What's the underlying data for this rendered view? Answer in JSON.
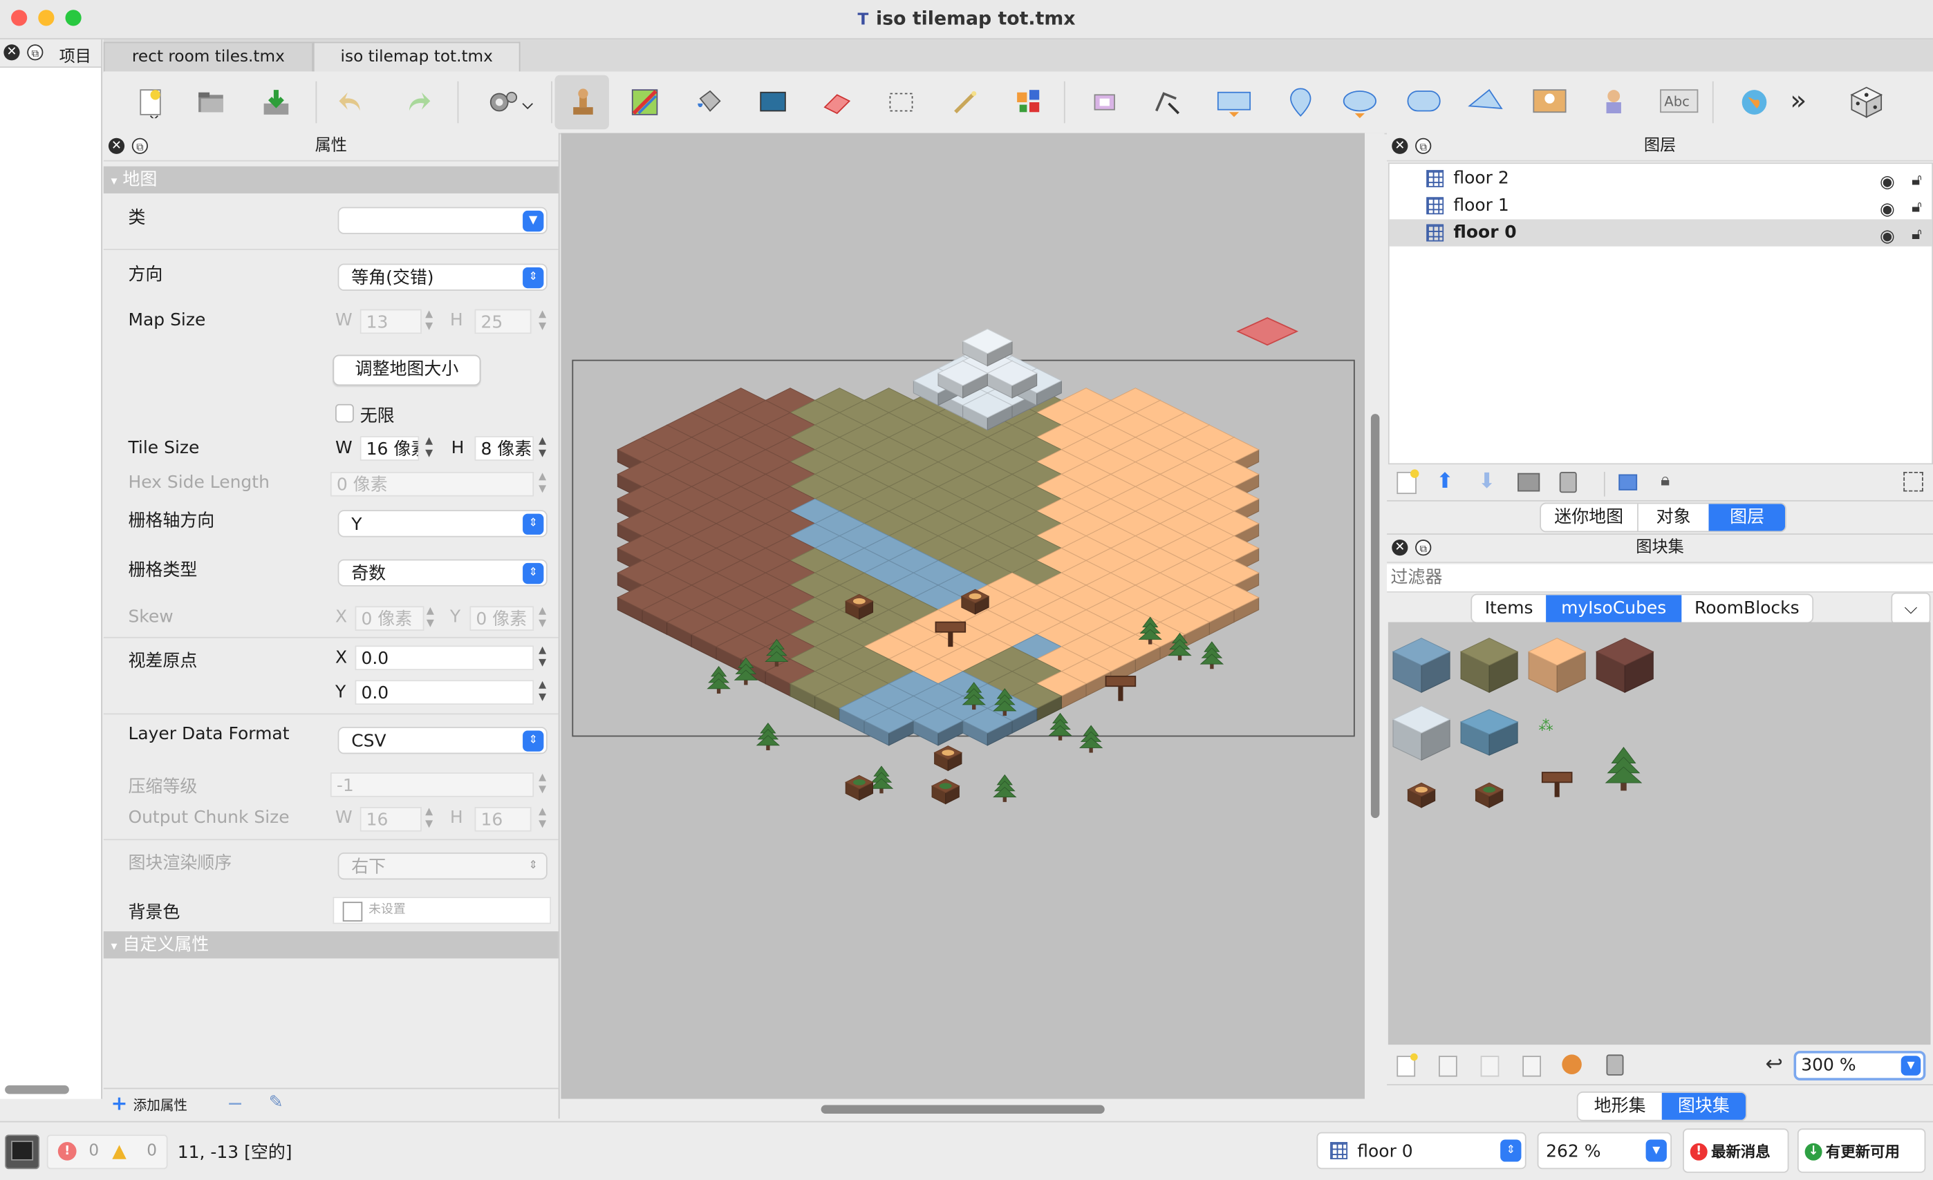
{
  "window": {
    "title": "iso tilemap tot.tmx",
    "traffic_light_colors": [
      "#fe5f57",
      "#febc2e",
      "#28c840"
    ]
  },
  "project_panel": {
    "title": "项目"
  },
  "tabs": [
    {
      "label": "rect room tiles.tmx",
      "active": false
    },
    {
      "label": "iso tilemap tot.tmx",
      "active": true
    }
  ],
  "toolbar": {
    "icons": [
      "new-map-icon",
      "open-icon",
      "save-icon",
      "undo-icon",
      "redo-icon",
      "command-gear-icon",
      "stamp-brush-icon",
      "terrain-brush-icon",
      "bucket-fill-icon",
      "shape-fill-icon",
      "eraser-icon",
      "rect-select-icon",
      "magic-wand-icon",
      "select-same-tile-icon",
      "select-objects-icon",
      "edit-polygons-icon",
      "insert-rectangle-icon",
      "insert-point-icon",
      "insert-ellipse-icon",
      "insert-capsule-icon",
      "insert-polygon-icon",
      "insert-tile-icon",
      "insert-template-icon",
      "insert-text-icon",
      "world-tool-icon",
      "more-icon",
      "random-mode-icon"
    ]
  },
  "properties": {
    "title": "属性",
    "section_map": "地图",
    "section_custom": "自定义属性",
    "class_label": "类",
    "class_value": "",
    "orientation_label": "方向",
    "orientation_value": "等角(交错)",
    "map_size_label": "Map Size",
    "w": "W",
    "h": "H",
    "map_w": "13",
    "map_h": "25",
    "resize_button": "调整地图大小",
    "infinite_label": "无限",
    "infinite_checked": false,
    "tile_size_label": "Tile Size",
    "tile_w": "16 像素",
    "tile_h": "8 像素",
    "hex_side_label": "Hex Side Length",
    "hex_side_value": "0 像素",
    "stagger_axis_label": "栅格轴方向",
    "stagger_axis_value": "Y",
    "stagger_index_label": "栅格类型",
    "stagger_index_value": "奇数",
    "skew_label": "Skew",
    "x": "X",
    "y": "Y",
    "skew_x": "0 像素",
    "skew_y": "0 像素",
    "parallax_label": "视差原点",
    "parallax_x": "0.0",
    "parallax_y": "0.0",
    "layer_format_label": "Layer Data Format",
    "layer_format_value": "CSV",
    "compression_label": "压缩等级",
    "compression_value": "-1",
    "chunk_label": "Output Chunk Size",
    "chunk_w": "16",
    "chunk_h": "16",
    "render_order_label": "图块渲染顺序",
    "render_order_value": "右下",
    "bg_color_label": "背景色",
    "bg_color_value": "未设置",
    "add_property": "添加属性"
  },
  "layers": {
    "title": "图层",
    "items": [
      {
        "name": "floor 2",
        "selected": false
      },
      {
        "name": "floor 1",
        "selected": false
      },
      {
        "name": "floor 0",
        "selected": true
      }
    ],
    "tabs": [
      "迷你地图",
      "对象",
      "图层"
    ],
    "active_tab": "图层"
  },
  "tilesets": {
    "title": "图块集",
    "filter_placeholder": "过滤器",
    "tabs": [
      "Items",
      "myIsoCubes",
      "RoomBlocks"
    ],
    "active_tab": "myIsoCubes",
    "zoom": "300 %",
    "bottom_tabs": [
      "地形集",
      "图块集"
    ],
    "active_bottom_tab": "图块集"
  },
  "status": {
    "errors": "0",
    "warnings": "0",
    "coords": "11, -13 [空的]",
    "current_layer": "floor 0",
    "zoom": "262 %",
    "news_button": "最新消息",
    "update_button": "有更新可用"
  },
  "colors": {
    "accent": "#2f7cf6",
    "canvas_bg": "#c0c0c0",
    "section_header": "#c6c6c6",
    "tile_sand": "#ffc28c",
    "tile_water": "#7ea6c4",
    "tile_grass": "#8d8a5f",
    "tile_dirt": "#8a5a4a"
  }
}
